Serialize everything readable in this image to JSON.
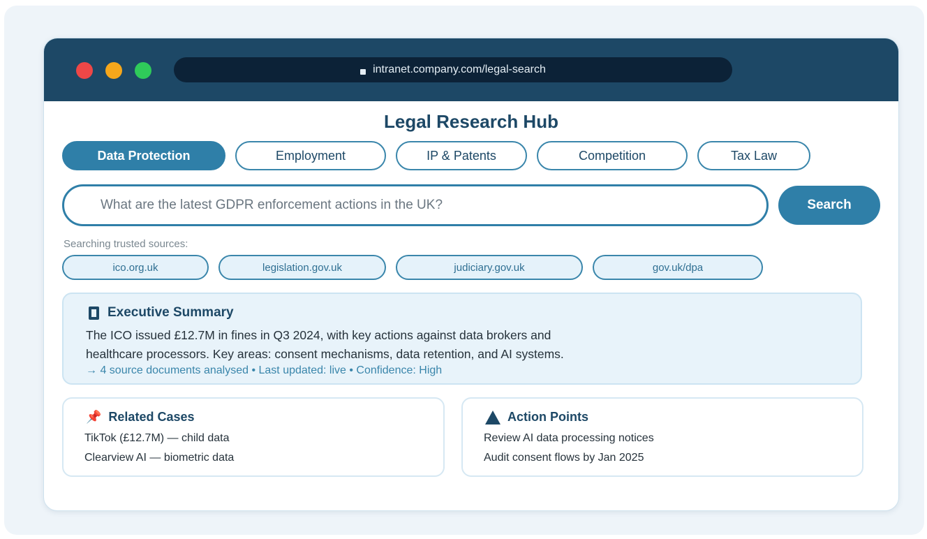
{
  "browser": {
    "url": "intranet.company.com/legal-search"
  },
  "page": {
    "title": "Legal Research Hub"
  },
  "tabs": [
    {
      "label": "Data Protection",
      "active": true
    },
    {
      "label": "Employment",
      "active": false
    },
    {
      "label": "IP & Patents",
      "active": false
    },
    {
      "label": "Competition",
      "active": false
    },
    {
      "label": "Tax Law",
      "active": false
    }
  ],
  "search": {
    "value": "What are the latest GDPR enforcement actions in the UK?",
    "button_label": "Search"
  },
  "sources": {
    "label": "Searching trusted sources:",
    "items": [
      "ico.org.uk",
      "legislation.gov.uk",
      "judiciary.gov.uk",
      "gov.uk/dpa"
    ]
  },
  "summary": {
    "title": "Executive Summary",
    "icon": "clipboard-icon",
    "lines": [
      "The ICO issued £12.7M in fines in Q3 2024, with key actions against data brokers and",
      "healthcare processors. Key areas: consent mechanisms, data retention, and AI systems."
    ],
    "meta": "→ 4 source documents analysed • Last updated: live • Confidence: High"
  },
  "related_cases": {
    "title": "Related Cases",
    "icon": "pin-icon",
    "items": [
      "TikTok (£12.7M) — child data",
      "Clearview AI — biometric data"
    ]
  },
  "action_points": {
    "title": "Action Points",
    "icon": "warning-icon",
    "items": [
      "Review AI data processing notices",
      "Audit consent flows by Jan 2025"
    ]
  },
  "colors": {
    "primary": "#1d4866",
    "accent": "#2f7fa8",
    "panel": "#e8f3fa"
  }
}
